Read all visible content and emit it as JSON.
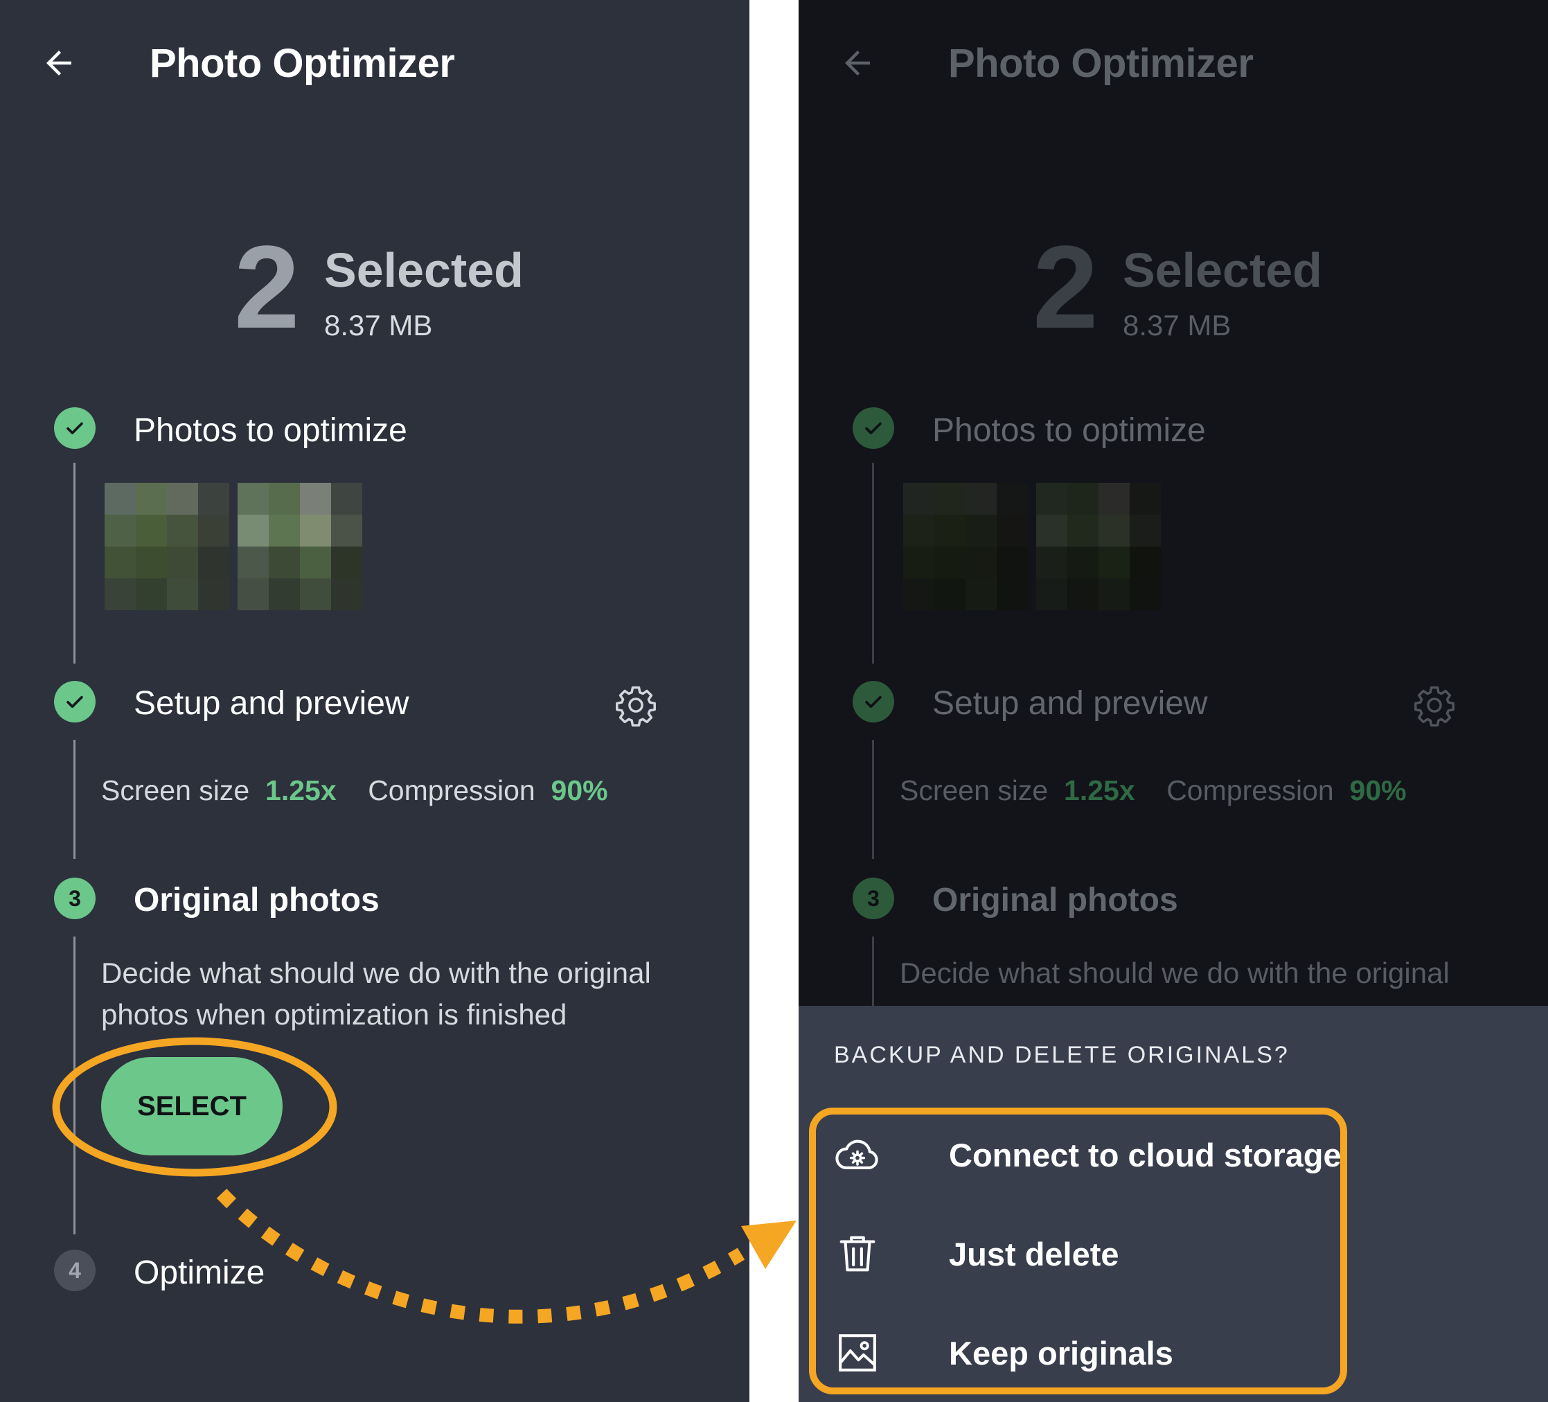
{
  "left": {
    "title": "Photo Optimizer",
    "selected_count": "2",
    "selected_label": "Selected",
    "selected_size": "8.37 MB",
    "steps": [
      {
        "number": "",
        "status": "done",
        "title": "Photos to optimize"
      },
      {
        "number": "",
        "status": "done",
        "title": "Setup and preview"
      },
      {
        "number": "3",
        "status": "active",
        "title": "Original photos"
      },
      {
        "number": "4",
        "status": "pending",
        "title": "Optimize"
      }
    ],
    "settings": {
      "screen_size_label": "Screen size",
      "screen_size_value": "1.25x",
      "compression_label": "Compression",
      "compression_value": "90%"
    },
    "description": "Decide what should we do with the original photos when optimization is finished",
    "select_label": "SELECT"
  },
  "right": {
    "title": "Photo Optimizer",
    "selected_count": "2",
    "selected_label": "Selected",
    "selected_size": "8.37 MB",
    "steps": [
      {
        "number": "",
        "status": "done",
        "title": "Photos to optimize"
      },
      {
        "number": "",
        "status": "done",
        "title": "Setup and preview"
      },
      {
        "number": "3",
        "status": "active",
        "title": "Original photos"
      }
    ],
    "settings": {
      "screen_size_label": "Screen size",
      "screen_size_value": "1.25x",
      "compression_label": "Compression",
      "compression_value": "90%"
    },
    "description": "Decide what should we do with the original",
    "sheet": {
      "header": "BACKUP AND DELETE ORIGINALS?",
      "options": [
        {
          "icon": "cloud-settings-icon",
          "label": "Connect to cloud storage"
        },
        {
          "icon": "trash-icon",
          "label": "Just delete"
        },
        {
          "icon": "image-icon",
          "label": "Keep originals"
        }
      ]
    }
  },
  "colors": {
    "accent_green": "#6cc78a",
    "highlight_orange": "#f5a623",
    "left_bg": "#2c313c",
    "right_bg": "#121419",
    "sheet_bg": "#393e4d"
  }
}
